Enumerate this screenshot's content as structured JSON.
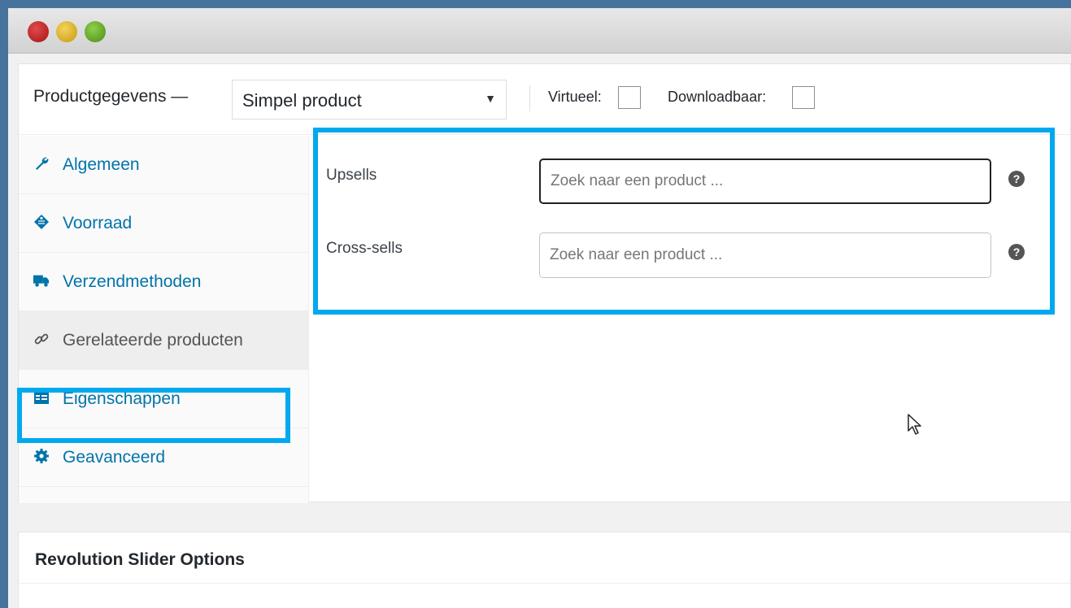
{
  "window": {
    "controls": [
      "close",
      "minimize",
      "maximize"
    ],
    "colors": {
      "close": "#c62828",
      "minimize": "#e0b22a",
      "maximize": "#6aa92f"
    }
  },
  "product_data": {
    "title": "Productgegevens —",
    "product_type": {
      "selected": "Simpel product",
      "arrow": "▼"
    },
    "virtual_label": "Virtueel:",
    "downloadable_label": "Downloadbaar:",
    "tabs": [
      {
        "label": "Algemeen",
        "icon": "wrench-icon"
      },
      {
        "label": "Voorraad",
        "icon": "tag-icon"
      },
      {
        "label": "Verzendmethoden",
        "icon": "truck-icon"
      },
      {
        "label": "Gerelateerde producten",
        "icon": "link-icon",
        "active": true
      },
      {
        "label": "Eigenschappen",
        "icon": "table-icon"
      },
      {
        "label": "Geavanceerd",
        "icon": "gear-icon"
      }
    ],
    "related": {
      "upsells": {
        "label": "Upsells",
        "placeholder": "Zoek naar een product ..."
      },
      "crosssells": {
        "label": "Cross-sells",
        "placeholder": "Zoek naar een product ..."
      },
      "help": "?"
    }
  },
  "revslider": {
    "title": "Revolution Slider Options"
  },
  "highlight_color": "#00a9ee",
  "link_color": "#0073aa"
}
